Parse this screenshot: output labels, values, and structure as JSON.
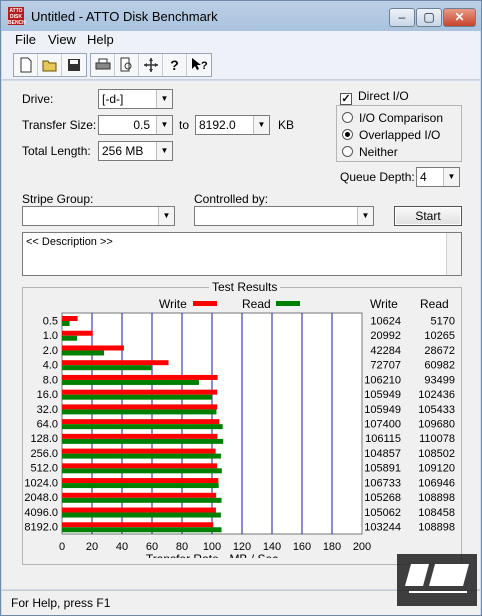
{
  "window": {
    "title": "Untitled - ATTO Disk Benchmark",
    "app_icon_text": "ATTO DISK BENCH"
  },
  "menu": [
    {
      "label": "File"
    },
    {
      "label": "View"
    },
    {
      "label": "Help"
    }
  ],
  "form": {
    "drive_label": "Drive:",
    "drive_value": "[-d-]",
    "transfer_size_label": "Transfer Size:",
    "transfer_from": "0.5",
    "to_label": "to",
    "transfer_to": "8192.0",
    "kb_label": "KB",
    "total_length_label": "Total Length:",
    "total_length_value": "256 MB",
    "direct_io_label": "Direct I/O",
    "direct_io_checked": true,
    "io_comparison_label": "I/O Comparison",
    "overlapped_io_label": "Overlapped I/O",
    "neither_label": "Neither",
    "selected_mode": "Overlapped I/O",
    "queue_depth_label": "Queue Depth:",
    "queue_depth_value": "4",
    "stripe_group_label": "Stripe Group:",
    "controlled_by_label": "Controlled by:",
    "start_label": "Start",
    "description_text": "<< Description >>"
  },
  "results": {
    "title": "Test Results",
    "write_legend": "Write",
    "read_legend": "Read",
    "write_col": "Write",
    "read_col": "Read"
  },
  "chart_data": {
    "type": "bar",
    "orientation": "horizontal",
    "xlabel": "Transfer Rate - MB / Sec",
    "xlim": [
      0,
      200
    ],
    "xticks": [
      0,
      20,
      40,
      60,
      80,
      100,
      120,
      140,
      160,
      180,
      200
    ],
    "categories": [
      "0.5",
      "1.0",
      "2.0",
      "4.0",
      "8.0",
      "16.0",
      "32.0",
      "64.0",
      "128.0",
      "256.0",
      "512.0",
      "1024.0",
      "2048.0",
      "4096.0",
      "8192.0"
    ],
    "series": [
      {
        "name": "Write",
        "color": "#ff0000",
        "values": [
          10624,
          20992,
          42284,
          72707,
          106210,
          105949,
          105949,
          107400,
          106115,
          104857,
          105891,
          106733,
          105268,
          105062,
          103244
        ]
      },
      {
        "name": "Read",
        "color": "#008000",
        "values": [
          5170,
          10265,
          28672,
          60982,
          93499,
          102436,
          105433,
          109680,
          110078,
          108502,
          109120,
          106946,
          108898,
          108458,
          108898
        ]
      }
    ],
    "grid": true
  },
  "status": {
    "text": "For Help, press F1"
  },
  "colors": {
    "write": "#ff0000",
    "read": "#008000",
    "grid": "#1a1aa8"
  }
}
